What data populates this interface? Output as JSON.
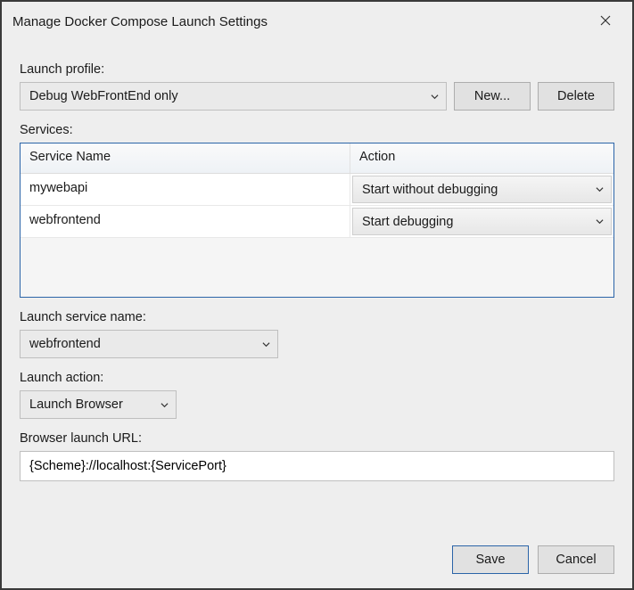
{
  "title": "Manage Docker Compose Launch Settings",
  "labels": {
    "launch_profile": "Launch profile:",
    "services": "Services:",
    "launch_service_name": "Launch service name:",
    "launch_action": "Launch action:",
    "browser_launch_url": "Browser launch URL:"
  },
  "profile": {
    "selected": "Debug WebFrontEnd only"
  },
  "buttons": {
    "new": "New...",
    "delete": "Delete",
    "save": "Save",
    "cancel": "Cancel"
  },
  "services_grid": {
    "headers": {
      "name": "Service Name",
      "action": "Action"
    },
    "rows": [
      {
        "name": "mywebapi",
        "action": "Start without debugging"
      },
      {
        "name": "webfrontend",
        "action": "Start debugging"
      }
    ]
  },
  "launch_service_name": {
    "selected": "webfrontend"
  },
  "launch_action": {
    "selected": "Launch Browser"
  },
  "browser_url": {
    "value": "{Scheme}://localhost:{ServicePort}"
  }
}
